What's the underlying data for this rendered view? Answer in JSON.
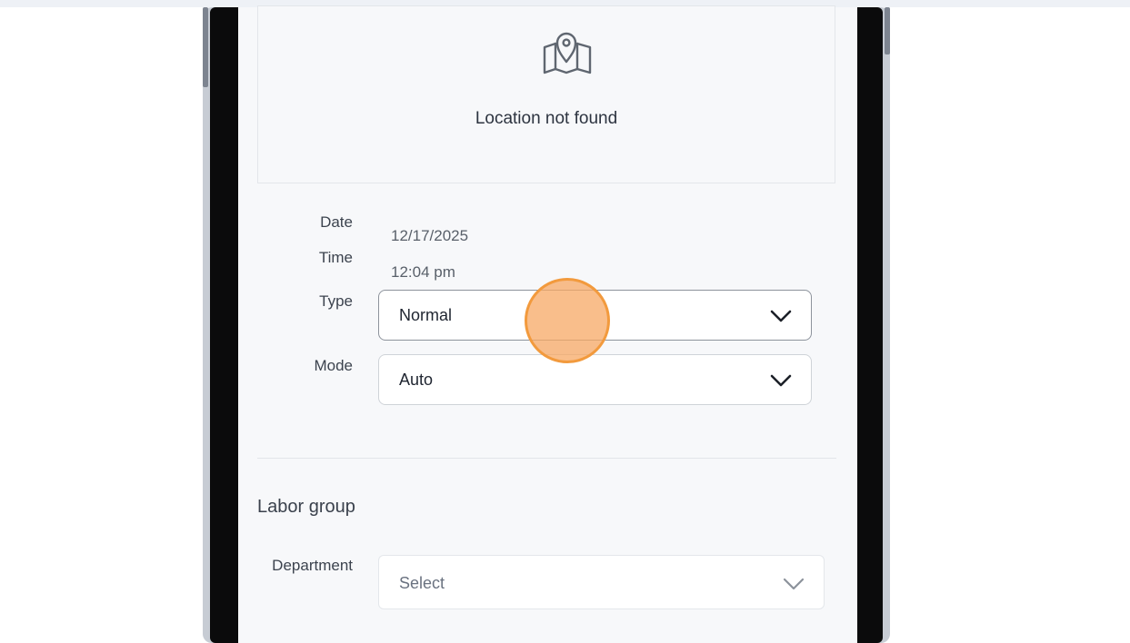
{
  "map": {
    "message": "Location not found",
    "icon": "map-pin-icon"
  },
  "details": {
    "date_label": "Date",
    "date_value": "12/17/2025",
    "time_label": "Time",
    "time_value": "12:04 pm",
    "type_label": "Type",
    "type_value": "Normal",
    "mode_label": "Mode",
    "mode_value": "Auto"
  },
  "labor_group": {
    "title": "Labor group",
    "department_label": "Department",
    "department_placeholder": "Select"
  },
  "colors": {
    "click_indicator": "#f29a3d",
    "screen_bg": "#f7f8fa",
    "bezel": "#0b0b0c"
  }
}
